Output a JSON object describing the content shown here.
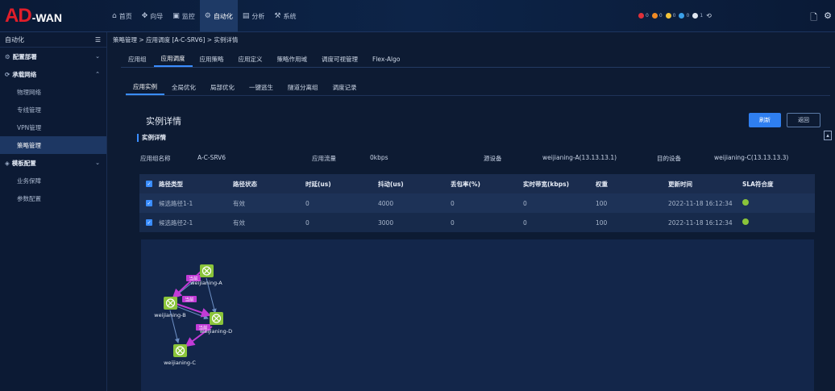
{
  "app": {
    "logo_main": "AD",
    "logo_sub": "-WAN"
  },
  "topnav": [
    {
      "icon": "⌂",
      "icon_name": "home-icon",
      "label": "首页"
    },
    {
      "icon": "✥",
      "icon_name": "wizard-icon",
      "label": "向导"
    },
    {
      "icon": "▣",
      "icon_name": "monitor-icon",
      "label": "监控"
    },
    {
      "icon": "⚙",
      "icon_name": "automation-icon",
      "label": "自动化",
      "active": true
    },
    {
      "icon": "▤",
      "icon_name": "analysis-icon",
      "label": "分析"
    },
    {
      "icon": "⚒",
      "icon_name": "system-icon",
      "label": "系统"
    }
  ],
  "status_indicators": [
    {
      "color": "#e0303a",
      "count": "0"
    },
    {
      "color": "#f08a24",
      "count": "0"
    },
    {
      "color": "#f2c33a",
      "count": "0"
    },
    {
      "color": "#3aa0e8",
      "count": "0"
    },
    {
      "color": "#e0e6f0",
      "count": "1"
    }
  ],
  "sidebar": {
    "header": "自动化",
    "items": [
      {
        "label": "配置部署",
        "group": true,
        "chev": "⌄",
        "icon": "⚙"
      },
      {
        "label": "承载网络",
        "group": true,
        "chev": "⌃",
        "icon": "⟳"
      },
      {
        "label": "物理网络"
      },
      {
        "label": "专线管理"
      },
      {
        "label": "VPN管理"
      },
      {
        "label": "策略管理",
        "active": true
      },
      {
        "label": "模板配置",
        "group": true,
        "chev": "⌄",
        "icon": "◈"
      },
      {
        "label": "业务保障"
      },
      {
        "label": "参数配置"
      }
    ]
  },
  "breadcrumb": "策略管理 > 应用调度 [A-C-SRV6] > 实例详情",
  "tabs_primary": [
    "应用组",
    "应用调度",
    "应用策略",
    "应用定义",
    "策略作用域",
    "调度可视管理",
    "Flex-Algo"
  ],
  "tabs_secondary": [
    "应用实例",
    "全局优化",
    "局部优化",
    "一键逃生",
    "隧道分离组",
    "调度记录"
  ],
  "panel": {
    "title": "实例详情",
    "refresh": "刷新",
    "back": "返回",
    "section": "实例详情"
  },
  "info": {
    "app_group_label": "应用组名称",
    "app_group_value": "A-C-SRV6",
    "traffic_label": "应用流量",
    "traffic_value": "0kbps",
    "src_label": "源设备",
    "src_value": "weijianing-A(13.13.13.1)",
    "dst_label": "目的设备",
    "dst_value": "weijianing-C(13.13.13.3)"
  },
  "table": {
    "headers": [
      "路径类型",
      "路径状态",
      "时延(us)",
      "抖动(us)",
      "丢包率(%)",
      "实时带宽(kbps)",
      "权重",
      "更新时间",
      "SLA符合度"
    ],
    "rows": [
      [
        "候选路径1-1",
        "有效",
        "0",
        "4000",
        "0",
        "0",
        "100",
        "2022-11-18 16:12:34"
      ],
      [
        "候选路径2-1",
        "有效",
        "0",
        "3000",
        "0",
        "0",
        "100",
        "2022-11-18 16:12:34"
      ]
    ]
  },
  "topology": {
    "nodes": [
      "weijianing-A",
      "weijianing-B",
      "weijianing-D",
      "weijianing-C"
    ],
    "tags": [
      "当前",
      "当前",
      "当前"
    ]
  }
}
